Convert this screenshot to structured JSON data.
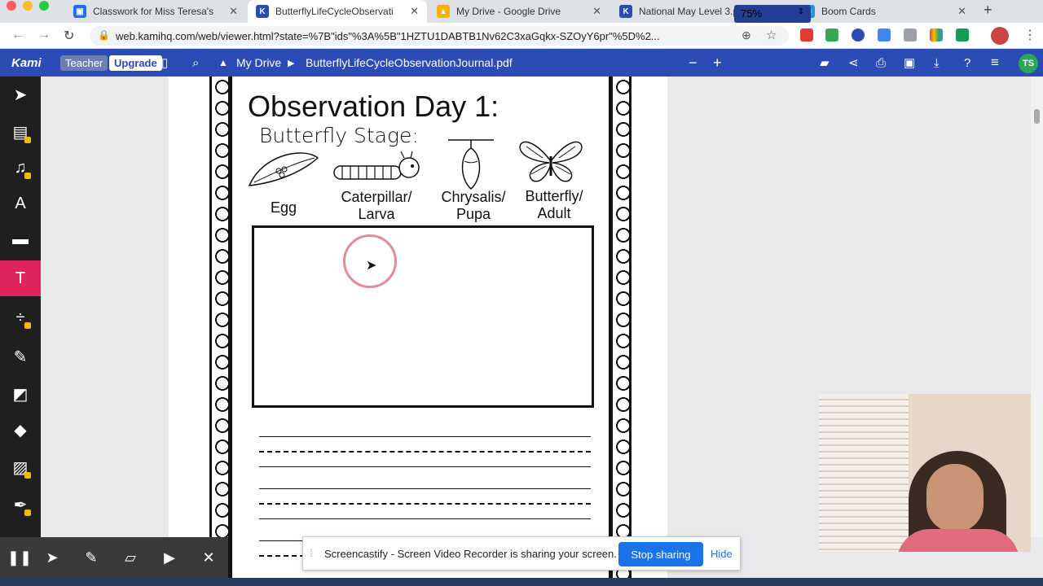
{
  "tabs": [
    {
      "title": "Classwork for Miss Teresa's",
      "icon": "classroom-icon",
      "color": "#1a73e8"
    },
    {
      "title": "ButterflyLifeCycleObservati",
      "icon": "kami-icon",
      "color": "#2b4bb5",
      "active": true
    },
    {
      "title": "My Drive - Google Drive",
      "icon": "drive-icon",
      "color": "#f4b400"
    },
    {
      "title": "National May Level 3.pdf",
      "icon": "kami-icon",
      "color": "#2b4bb5"
    },
    {
      "title": "Boom Cards",
      "icon": "boom-cards-icon",
      "color": "#1a9be0"
    }
  ],
  "address": {
    "url": "web.kamihq.com/web/viewer.html?state=%7B\"ids\"%3A%5B\"1HZTU1DABTB1Nv62C3xaGqkx-SZOyY6pr\"%5D%2..."
  },
  "kami": {
    "logo": "Kami",
    "teacher": "Teacher",
    "upgrade": "Upgrade",
    "drive": "My Drive",
    "file": "ButterflyLifeCycleObservationJournal.pdf",
    "zoom": "75%",
    "avatar": "TS"
  },
  "doc": {
    "title": "Observation Day 1:",
    "subtitle": "Butterfly Stage:",
    "stages": [
      {
        "line1": "Egg",
        "line2": ""
      },
      {
        "line1": "Caterpillar/",
        "line2": "Larva"
      },
      {
        "line1": "Chrysalis/",
        "line2": "Pupa"
      },
      {
        "line1": "Butterfly/",
        "line2": "Adult"
      }
    ]
  },
  "share": {
    "message": "Screencastify - Screen Video Recorder is sharing your screen.",
    "stop": "Stop sharing",
    "hide": "Hide"
  }
}
